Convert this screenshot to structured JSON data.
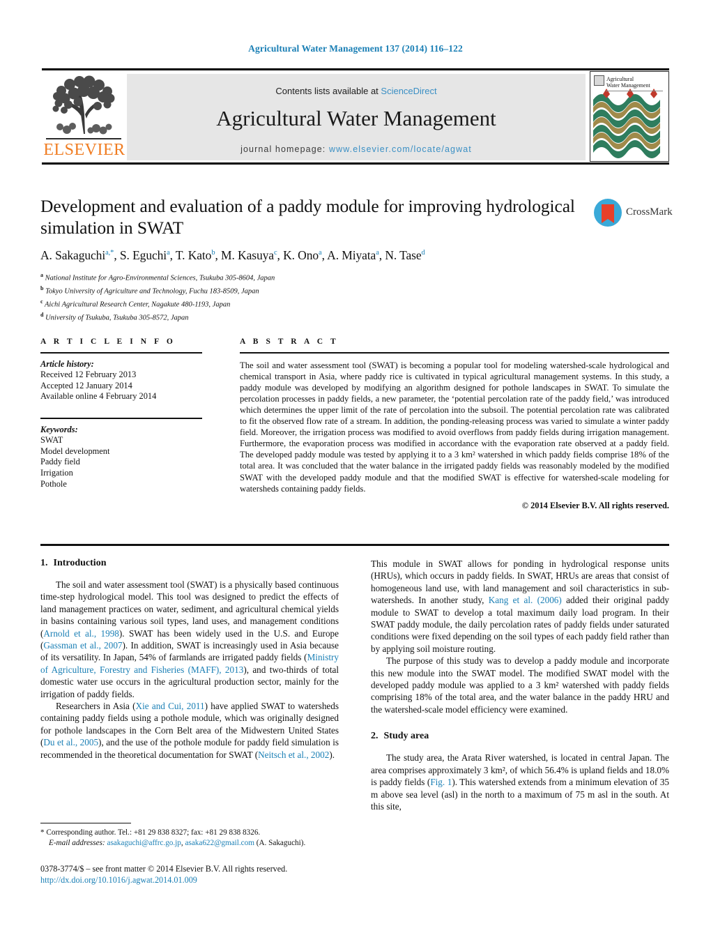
{
  "running_head": "Agricultural Water Management 137 (2014) 116–122",
  "masthead": {
    "contents_prefix": "Contents lists available at ",
    "sciencedirect": "ScienceDirect",
    "journal_name": "Agricultural Water Management",
    "homepage_prefix": "journal homepage: ",
    "homepage_url": "www.elsevier.com/locate/agwat",
    "publisher": "ELSEVIER",
    "cover_title_line1": "Agricultural",
    "cover_title_line2": "Water Management",
    "colors": {
      "link": "#3a8fc4",
      "banner_bg": "#e6e6e6",
      "elsevier_orange": "#f07c21",
      "running_head": "#1a7fb5"
    }
  },
  "title_block": {
    "title": "Development and evaluation of a paddy module for improving hydrological simulation in SWAT",
    "authors": [
      {
        "name": "A. Sakaguchi",
        "marks": "a,*"
      },
      {
        "name": "S. Eguchi",
        "marks": "a"
      },
      {
        "name": "T. Kato",
        "marks": "b"
      },
      {
        "name": "M. Kasuya",
        "marks": "c"
      },
      {
        "name": "K. Ono",
        "marks": "a"
      },
      {
        "name": "A. Miyata",
        "marks": "a"
      },
      {
        "name": "N. Tase",
        "marks": "d"
      }
    ],
    "affiliations": [
      {
        "mark": "a",
        "text": "National Institute for Agro-Environmental Sciences, Tsukuba 305-8604, Japan"
      },
      {
        "mark": "b",
        "text": "Tokyo University of Agriculture and Technology, Fuchu 183-8509, Japan"
      },
      {
        "mark": "c",
        "text": "Aichi Agricultural Research Center, Nagakute 480-1193, Japan"
      },
      {
        "mark": "d",
        "text": "University of Tsukuba, Tsukuba 305-8572, Japan"
      }
    ],
    "crossmark_label": "CrossMark"
  },
  "article_info": {
    "heading": "A R T I C L E   I N F O",
    "history_label": "Article history:",
    "history": [
      "Received 12 February 2013",
      "Accepted 12 January 2014",
      "Available online 4 February 2014"
    ],
    "keywords_label": "Keywords:",
    "keywords": [
      "SWAT",
      "Model development",
      "Paddy field",
      "Irrigation",
      "Pothole"
    ]
  },
  "abstract": {
    "heading": "A B S T R A C T",
    "text": "The soil and water assessment tool (SWAT) is becoming a popular tool for modeling watershed-scale hydrological and chemical transport in Asia, where paddy rice is cultivated in typical agricultural management systems. In this study, a paddy module was developed by modifying an algorithm designed for pothole landscapes in SWAT. To simulate the percolation processes in paddy fields, a new parameter, the ‘potential percolation rate of the paddy field,’ was introduced which determines the upper limit of the rate of percolation into the subsoil. The potential percolation rate was calibrated to fit the observed flow rate of a stream. In addition, the ponding-releasing process was varied to simulate a winter paddy field. Moreover, the irrigation process was modified to avoid overflows from paddy fields during irrigation management. Furthermore, the evaporation process was modified in accordance with the evaporation rate observed at a paddy field. The developed paddy module was tested by applying it to a 3 km² watershed in which paddy fields comprise 18% of the total area. It was concluded that the water balance in the irrigated paddy fields was reasonably modeled by the modified SWAT with the developed paddy module and that the modified SWAT is effective for watershed-scale modeling for watersheds containing paddy fields.",
    "copyright": "© 2014 Elsevier B.V. All rights reserved."
  },
  "body": {
    "left": {
      "section_num": "1.",
      "section_title": "Introduction",
      "para1_a": "The soil and water assessment tool (SWAT) is a physically based continuous time-step hydrological model. This tool was designed to predict the effects of land management practices on water, sediment, and agricultural chemical yields in basins containing various soil types, land uses, and management conditions (",
      "ref1": "Arnold et al., 1998",
      "para1_b": "). SWAT has been widely used in the U.S. and Europe (",
      "ref2": "Gassman et al., 2007",
      "para1_c": "). In addition, SWAT is increasingly used in Asia because of its versatility. In Japan, 54% of farmlands are irrigated paddy fields (",
      "ref3": "Ministry of Agriculture, Forestry and Fisheries (MAFF), 2013",
      "para1_d": "), and two-thirds of total domestic water use occurs in the agricultural production sector, mainly for the irrigation of paddy fields.",
      "para2_a": "Researchers in Asia (",
      "ref4": "Xie and Cui, 2011",
      "para2_b": ") have applied SWAT to watersheds containing paddy fields using a pothole module, which was originally designed for pothole landscapes in the Corn Belt area of the Midwestern United States (",
      "ref5": "Du et al., 2005",
      "para2_c": "), and the use of the pothole module for paddy field simulation is recommended in the theoretical documentation for SWAT (",
      "ref6": "Neitsch et al., 2002",
      "para2_d": ")."
    },
    "right": {
      "para1_a": "This module in SWAT allows for ponding in hydrological response units (HRUs), which occurs in paddy fields. In SWAT, HRUs are areas that consist of homogeneous land use, with land management and soil characteristics in sub-watersheds. In another study, ",
      "ref1": "Kang et al. (2006)",
      "para1_b": " added their original paddy module to SWAT to develop a total maximum daily load program. In their SWAT paddy module, the daily percolation rates of paddy fields under saturated conditions were fixed depending on the soil types of each paddy field rather than by applying soil moisture routing.",
      "para2": "The purpose of this study was to develop a paddy module and incorporate this new module into the SWAT model. The modified SWAT model with the developed paddy module was applied to a 3 km² watershed with paddy fields comprising 18% of the total area, and the water balance in the paddy HRU and the watershed-scale model efficiency were examined.",
      "section_num": "2.",
      "section_title": "Study area",
      "para3_a": "The study area, the Arata River watershed, is located in central Japan. The area comprises approximately 3 km², of which 56.4% is upland fields and 18.0% is paddy fields (",
      "ref2": "Fig. 1",
      "para3_b": "). This watershed extends from a minimum elevation of 35 m above sea level (asl) in the north to a maximum of 75 m asl in the south. At this site,"
    }
  },
  "footnote": {
    "star": "*",
    "corresponding": "Corresponding author. Tel.: +81 29 838 8327; fax: +81 29 838 8326.",
    "email_label": "E-mail addresses:",
    "email1": "asakaguchi@affrc.go.jp",
    "email2": "asaka622@gmail.com",
    "email_owner": "(A. Sakaguchi)."
  },
  "imprint": {
    "line1": "0378-3774/$ – see front matter © 2014 Elsevier B.V. All rights reserved.",
    "doi": "http://dx.doi.org/10.1016/j.agwat.2014.01.009"
  }
}
